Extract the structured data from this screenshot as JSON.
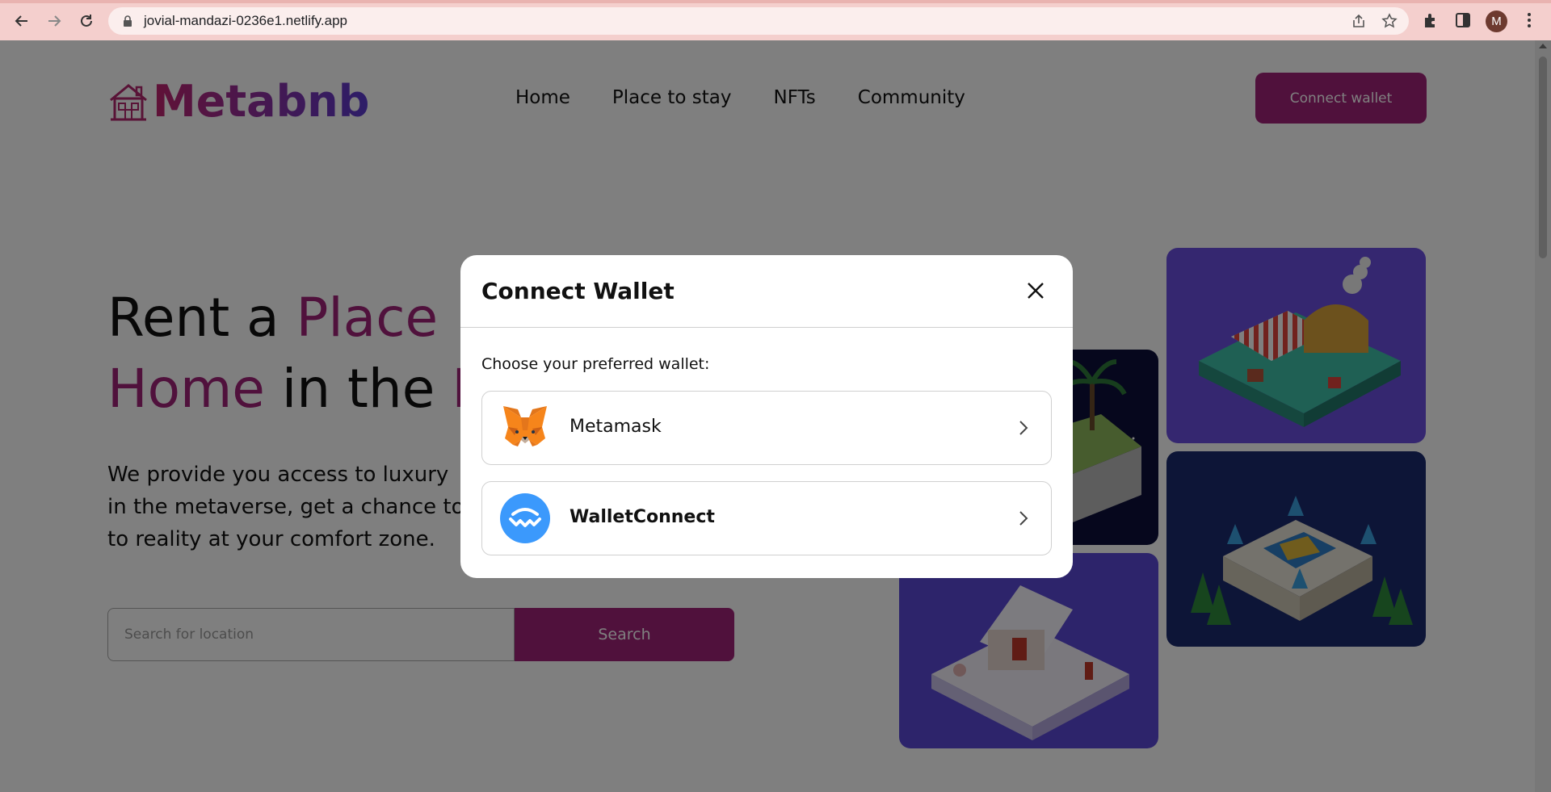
{
  "browser": {
    "url": "jovial-mandazi-0236e1.netlify.app",
    "avatar_initial": "M"
  },
  "header": {
    "logo_text": "Metabnb",
    "nav": [
      "Home",
      "Place to stay",
      "NFTs",
      "Community"
    ],
    "connect_label": "Connect wallet"
  },
  "hero": {
    "title_line1_a": "Rent a ",
    "title_line1_b": "Place",
    "title_line2_a": "Home",
    "title_line2_b": " in the ",
    "title_line2_c": "M",
    "description": "We provide you access to luxury\nin the metaverse, get a chance to\nto reality at your comfort zone.",
    "search_placeholder": "Search for location",
    "search_label": "Search"
  },
  "modal": {
    "title": "Connect Wallet",
    "subtitle": "Choose your preferred wallet:",
    "options": [
      {
        "label": "Metamask",
        "icon": "metamask-fox-icon"
      },
      {
        "label": "WalletConnect",
        "icon": "walletconnect-icon"
      }
    ]
  },
  "colors": {
    "accent": "#a02279",
    "walletconnect_blue": "#3b99fc"
  }
}
